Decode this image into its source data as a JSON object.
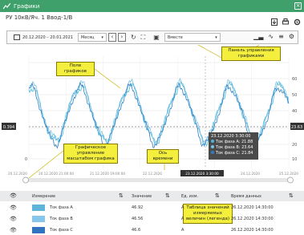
{
  "window": {
    "title": "Графики",
    "subtitle": "РУ 10кВ/Яч. 1 Ввод-1/В"
  },
  "toolbar": {
    "date_range": "20.12.2020 – 20.01.2021",
    "period": "Месяц",
    "group": "Вместе"
  },
  "chart_data": {
    "type": "line",
    "y_ticks_left": [
      "0"
    ],
    "y_ticks_right": [
      "10",
      "20",
      "30",
      "40",
      "50",
      "60"
    ],
    "current_left": "0.394",
    "current_right": "23.63",
    "x_labels": [
      "20.12.2020",
      "20.12.2020 21:00:00",
      "21.12.2020 19:00:00",
      "22.12.2020",
      "23.12.2020 3:30:00",
      "24.12.2020",
      "25.12.2020"
    ],
    "series": [
      {
        "name": "Ток фаза A",
        "color": "#4ab7d8"
      },
      {
        "name": "Ток фаза B",
        "color": "#75c3e6"
      },
      {
        "name": "Ток фаза C",
        "color": "#2f7ec4"
      }
    ]
  },
  "annotations": {
    "field": "Поле\nграфиков",
    "panel": "Панель управления\nграфиками",
    "scale": "Графическое\nуправление\nмасштабом графика",
    "axis": "Ось\nвремени",
    "legend_table": "Таблица значений\nизмеряемых\nвеличин (легенда)"
  },
  "tooltip": {
    "time": "23.12.2020 3:30:00",
    "rows": [
      "Ток фаза A: 21.88",
      "Ток фаза B: 23.64",
      "Ток фаза C: 21.84"
    ]
  },
  "table": {
    "headers": [
      "Измерение",
      "Значение",
      "Ед. изм.",
      "Время данных"
    ],
    "rows": [
      {
        "name": "Ток фаза A",
        "value": "46.92",
        "unit": "А",
        "time": "26.12.2020 14:30:00",
        "color": "#5fb4dc"
      },
      {
        "name": "Ток фаза B",
        "value": "46.56",
        "unit": "А",
        "time": "26.12.2020 14:30:00",
        "color": "#87c8ea"
      },
      {
        "name": "Ток фаза C",
        "value": "46.6",
        "unit": "А",
        "time": "26.12.2020 14:30:00",
        "color": "#2f73c1"
      }
    ]
  }
}
